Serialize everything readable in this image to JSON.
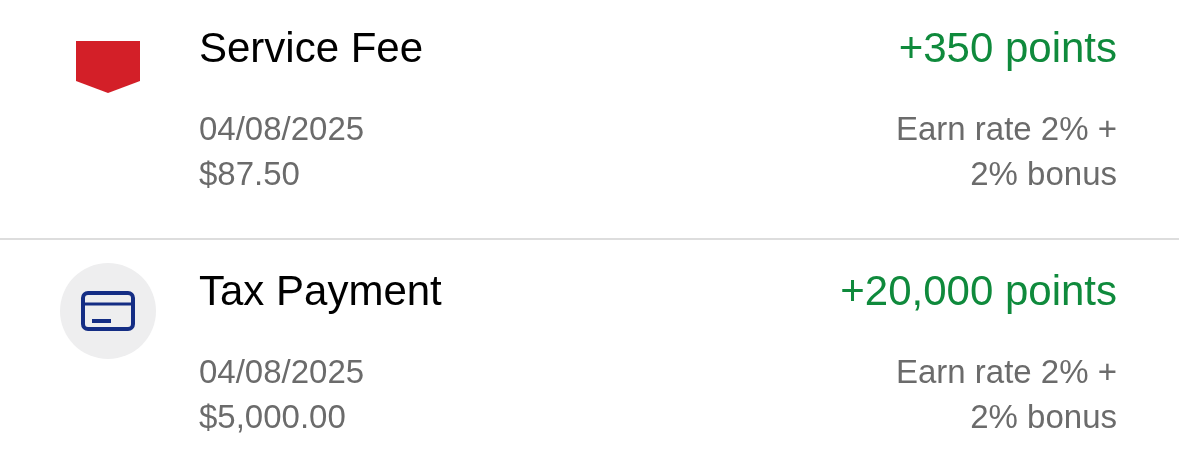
{
  "transactions": [
    {
      "kind": "shield",
      "title": "Service Fee",
      "points": "+350 points",
      "date": "04/08/2025",
      "amount": "$87.50",
      "rate_line_1": "Earn rate 2% +",
      "rate_line_2": "2% bonus"
    },
    {
      "kind": "card",
      "title": "Tax Payment",
      "points": "+20,000 points",
      "date": "04/08/2025",
      "amount": "$5,000.00",
      "rate_line_1": "Earn rate 2% +",
      "rate_line_2": "2% bonus"
    }
  ]
}
